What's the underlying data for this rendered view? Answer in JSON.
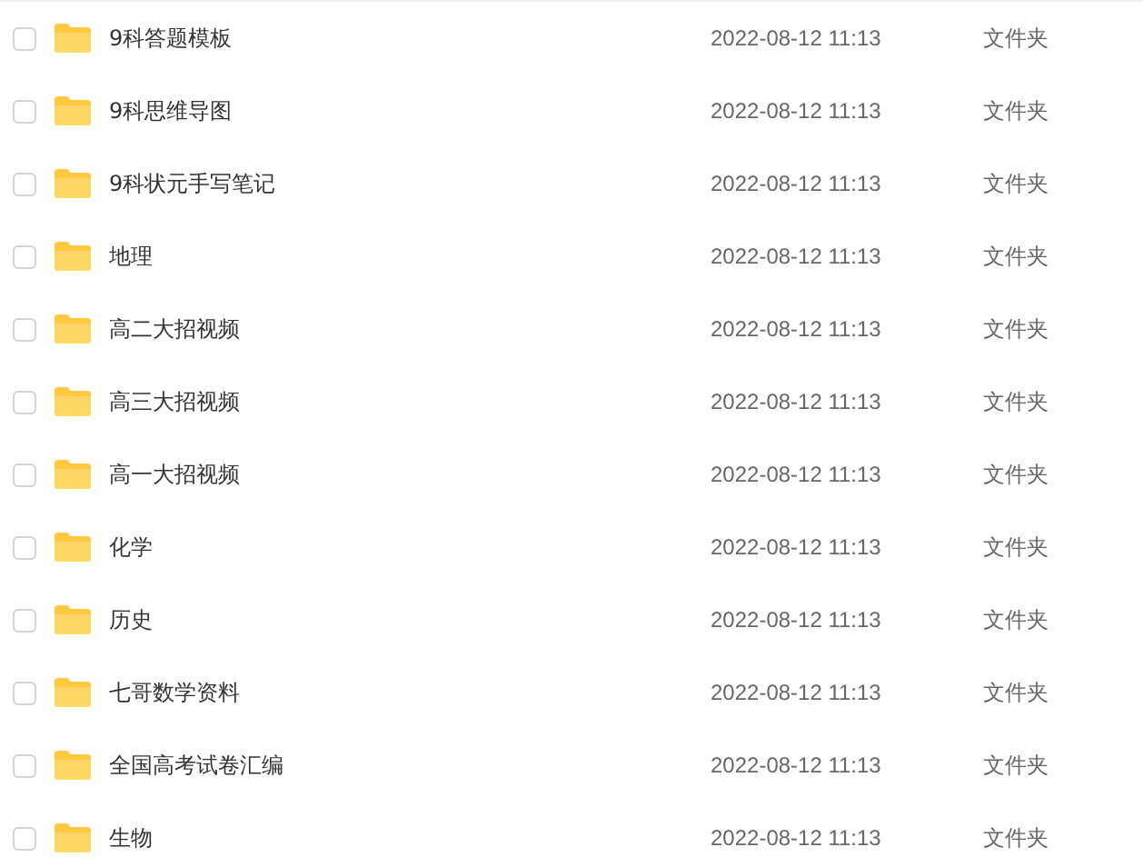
{
  "files": [
    {
      "name": "9科答题模板",
      "modified": "2022-08-12 11:13",
      "type": "文件夹",
      "checked": false
    },
    {
      "name": "9科思维导图",
      "modified": "2022-08-12 11:13",
      "type": "文件夹",
      "checked": false
    },
    {
      "name": "9科状元手写笔记",
      "modified": "2022-08-12 11:13",
      "type": "文件夹",
      "checked": false
    },
    {
      "name": "地理",
      "modified": "2022-08-12 11:13",
      "type": "文件夹",
      "checked": false
    },
    {
      "name": "高二大招视频",
      "modified": "2022-08-12 11:13",
      "type": "文件夹",
      "checked": false
    },
    {
      "name": "高三大招视频",
      "modified": "2022-08-12 11:13",
      "type": "文件夹",
      "checked": false
    },
    {
      "name": "高一大招视频",
      "modified": "2022-08-12 11:13",
      "type": "文件夹",
      "checked": false
    },
    {
      "name": "化学",
      "modified": "2022-08-12 11:13",
      "type": "文件夹",
      "checked": false
    },
    {
      "name": "历史",
      "modified": "2022-08-12 11:13",
      "type": "文件夹",
      "checked": false
    },
    {
      "name": "七哥数学资料",
      "modified": "2022-08-12 11:13",
      "type": "文件夹",
      "checked": false
    },
    {
      "name": "全国高考试卷汇编",
      "modified": "2022-08-12 11:13",
      "type": "文件夹",
      "checked": false
    },
    {
      "name": "生物",
      "modified": "2022-08-12 11:13",
      "type": "文件夹",
      "checked": false
    }
  ]
}
